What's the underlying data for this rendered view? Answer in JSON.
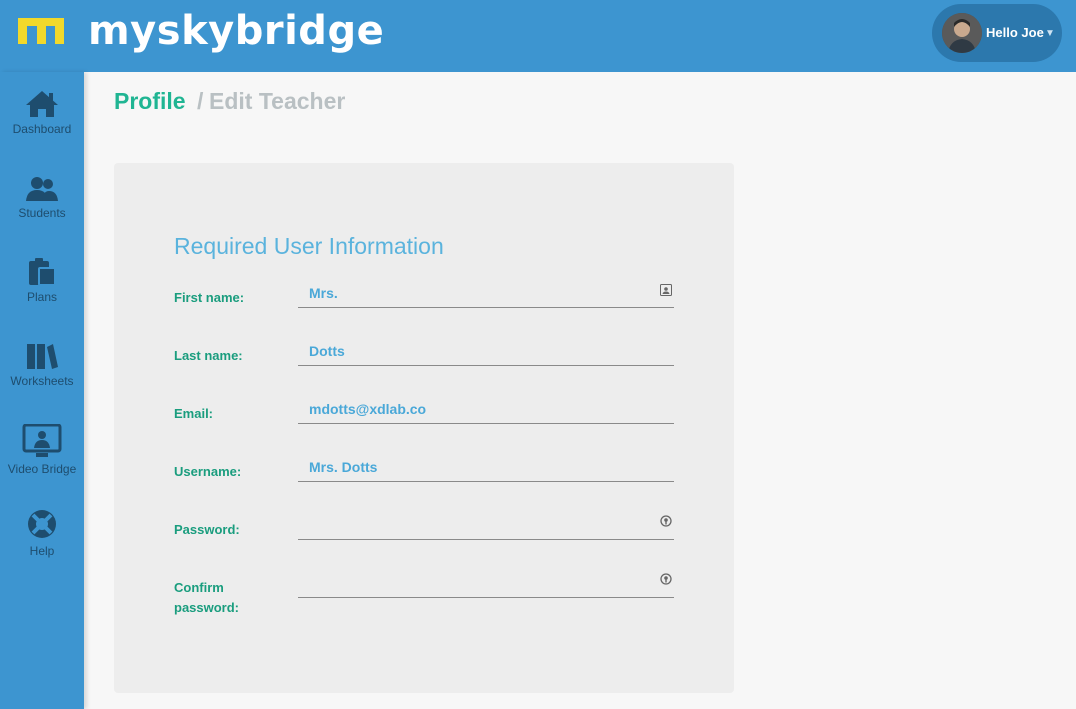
{
  "brand": {
    "name": "myskybridge",
    "colors": {
      "bar": "#3d95d0",
      "logo": "#f2d92b",
      "accent": "#20b593",
      "heading": "#5ab3dd"
    }
  },
  "user": {
    "greeting": "Hello Joe"
  },
  "sidebar": {
    "items": [
      {
        "label": "Dashboard",
        "icon": "home-icon"
      },
      {
        "label": "Students",
        "icon": "users-icon"
      },
      {
        "label": "Plans",
        "icon": "clipboard-icon"
      },
      {
        "label": "Worksheets",
        "icon": "books-icon"
      },
      {
        "label": "Video Bridge",
        "icon": "monitor-icon"
      },
      {
        "label": "Help",
        "icon": "lifebuoy-icon"
      }
    ]
  },
  "breadcrumb": {
    "root": "Profile",
    "separator": "/",
    "current": "Edit Teacher"
  },
  "form": {
    "title": "Required User Information",
    "fields": [
      {
        "label": "First name:",
        "value": "Mrs.",
        "icon": "contact-card-icon"
      },
      {
        "label": "Last name:",
        "value": "Dotts"
      },
      {
        "label": "Email:",
        "value": "mdotts@xdlab.co"
      },
      {
        "label": "Username:",
        "value": "Mrs. Dotts"
      },
      {
        "label": "Password:",
        "value": "",
        "icon": "key-icon"
      },
      {
        "label": "Confirm password:",
        "value": "",
        "icon": "key-icon"
      }
    ]
  }
}
